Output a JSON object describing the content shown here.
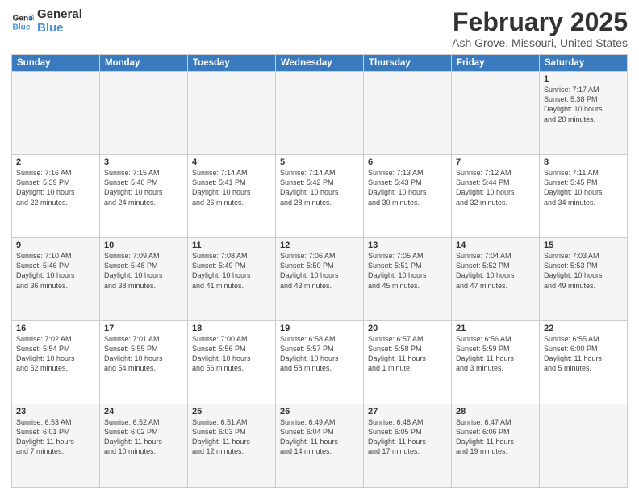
{
  "header": {
    "logo_line1": "General",
    "logo_line2": "Blue",
    "month": "February 2025",
    "location": "Ash Grove, Missouri, United States"
  },
  "weekdays": [
    "Sunday",
    "Monday",
    "Tuesday",
    "Wednesday",
    "Thursday",
    "Friday",
    "Saturday"
  ],
  "weeks": [
    [
      {
        "day": "",
        "info": ""
      },
      {
        "day": "",
        "info": ""
      },
      {
        "day": "",
        "info": ""
      },
      {
        "day": "",
        "info": ""
      },
      {
        "day": "",
        "info": ""
      },
      {
        "day": "",
        "info": ""
      },
      {
        "day": "1",
        "info": "Sunrise: 7:17 AM\nSunset: 5:38 PM\nDaylight: 10 hours\nand 20 minutes."
      }
    ],
    [
      {
        "day": "2",
        "info": "Sunrise: 7:16 AM\nSunset: 5:39 PM\nDaylight: 10 hours\nand 22 minutes."
      },
      {
        "day": "3",
        "info": "Sunrise: 7:15 AM\nSunset: 5:40 PM\nDaylight: 10 hours\nand 24 minutes."
      },
      {
        "day": "4",
        "info": "Sunrise: 7:14 AM\nSunset: 5:41 PM\nDaylight: 10 hours\nand 26 minutes."
      },
      {
        "day": "5",
        "info": "Sunrise: 7:14 AM\nSunset: 5:42 PM\nDaylight: 10 hours\nand 28 minutes."
      },
      {
        "day": "6",
        "info": "Sunrise: 7:13 AM\nSunset: 5:43 PM\nDaylight: 10 hours\nand 30 minutes."
      },
      {
        "day": "7",
        "info": "Sunrise: 7:12 AM\nSunset: 5:44 PM\nDaylight: 10 hours\nand 32 minutes."
      },
      {
        "day": "8",
        "info": "Sunrise: 7:11 AM\nSunset: 5:45 PM\nDaylight: 10 hours\nand 34 minutes."
      }
    ],
    [
      {
        "day": "9",
        "info": "Sunrise: 7:10 AM\nSunset: 5:46 PM\nDaylight: 10 hours\nand 36 minutes."
      },
      {
        "day": "10",
        "info": "Sunrise: 7:09 AM\nSunset: 5:48 PM\nDaylight: 10 hours\nand 38 minutes."
      },
      {
        "day": "11",
        "info": "Sunrise: 7:08 AM\nSunset: 5:49 PM\nDaylight: 10 hours\nand 41 minutes."
      },
      {
        "day": "12",
        "info": "Sunrise: 7:06 AM\nSunset: 5:50 PM\nDaylight: 10 hours\nand 43 minutes."
      },
      {
        "day": "13",
        "info": "Sunrise: 7:05 AM\nSunset: 5:51 PM\nDaylight: 10 hours\nand 45 minutes."
      },
      {
        "day": "14",
        "info": "Sunrise: 7:04 AM\nSunset: 5:52 PM\nDaylight: 10 hours\nand 47 minutes."
      },
      {
        "day": "15",
        "info": "Sunrise: 7:03 AM\nSunset: 5:53 PM\nDaylight: 10 hours\nand 49 minutes."
      }
    ],
    [
      {
        "day": "16",
        "info": "Sunrise: 7:02 AM\nSunset: 5:54 PM\nDaylight: 10 hours\nand 52 minutes."
      },
      {
        "day": "17",
        "info": "Sunrise: 7:01 AM\nSunset: 5:55 PM\nDaylight: 10 hours\nand 54 minutes."
      },
      {
        "day": "18",
        "info": "Sunrise: 7:00 AM\nSunset: 5:56 PM\nDaylight: 10 hours\nand 56 minutes."
      },
      {
        "day": "19",
        "info": "Sunrise: 6:58 AM\nSunset: 5:57 PM\nDaylight: 10 hours\nand 58 minutes."
      },
      {
        "day": "20",
        "info": "Sunrise: 6:57 AM\nSunset: 5:58 PM\nDaylight: 11 hours\nand 1 minute."
      },
      {
        "day": "21",
        "info": "Sunrise: 6:56 AM\nSunset: 5:59 PM\nDaylight: 11 hours\nand 3 minutes."
      },
      {
        "day": "22",
        "info": "Sunrise: 6:55 AM\nSunset: 6:00 PM\nDaylight: 11 hours\nand 5 minutes."
      }
    ],
    [
      {
        "day": "23",
        "info": "Sunrise: 6:53 AM\nSunset: 6:01 PM\nDaylight: 11 hours\nand 7 minutes."
      },
      {
        "day": "24",
        "info": "Sunrise: 6:52 AM\nSunset: 6:02 PM\nDaylight: 11 hours\nand 10 minutes."
      },
      {
        "day": "25",
        "info": "Sunrise: 6:51 AM\nSunset: 6:03 PM\nDaylight: 11 hours\nand 12 minutes."
      },
      {
        "day": "26",
        "info": "Sunrise: 6:49 AM\nSunset: 6:04 PM\nDaylight: 11 hours\nand 14 minutes."
      },
      {
        "day": "27",
        "info": "Sunrise: 6:48 AM\nSunset: 6:05 PM\nDaylight: 11 hours\nand 17 minutes."
      },
      {
        "day": "28",
        "info": "Sunrise: 6:47 AM\nSunset: 6:06 PM\nDaylight: 11 hours\nand 19 minutes."
      },
      {
        "day": "",
        "info": ""
      }
    ]
  ]
}
